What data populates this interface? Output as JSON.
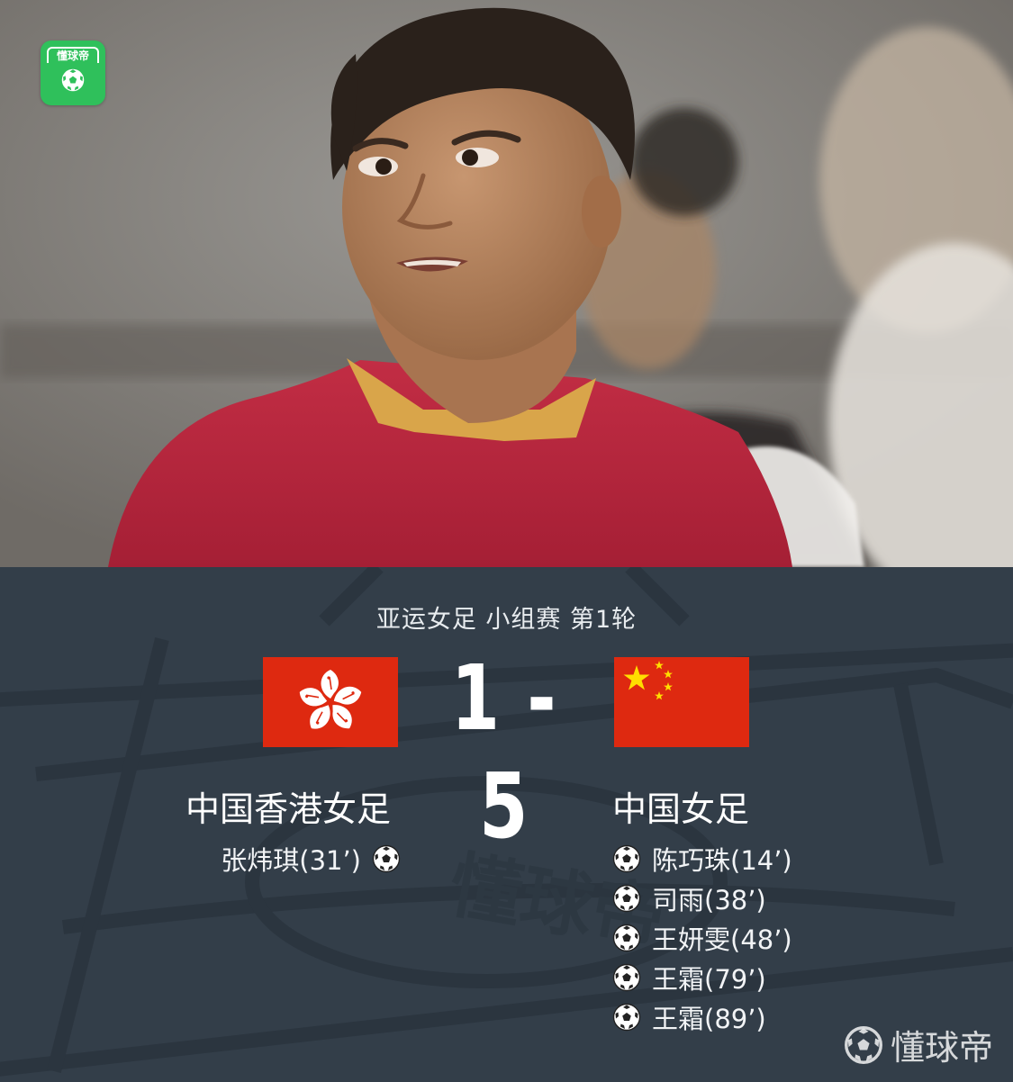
{
  "photo": {
    "app_logo_text": "懂球帝",
    "jersey_color": "#b3253b"
  },
  "match": {
    "label": "亚运女足 小组赛 第1轮",
    "score": "1 - 5",
    "home_flag": "hong-kong-flag",
    "away_flag": "china-flag"
  },
  "home": {
    "name": "中国香港女足",
    "scorers": [
      {
        "text": "张炜琪(31’)"
      }
    ]
  },
  "away": {
    "name": "中国女足",
    "scorers": [
      {
        "text": "陈巧珠(14’)"
      },
      {
        "text": "司雨(38’)"
      },
      {
        "text": "王妍雯(48’)"
      },
      {
        "text": "王霜(79’)"
      },
      {
        "text": "王霜(89’)"
      }
    ]
  },
  "watermark": {
    "text": "懂球帝"
  },
  "colors": {
    "panel_bg": "#333e49",
    "flag_red": "#de2910",
    "star_yellow": "#ffde00",
    "brand_green": "#2fc05b"
  }
}
